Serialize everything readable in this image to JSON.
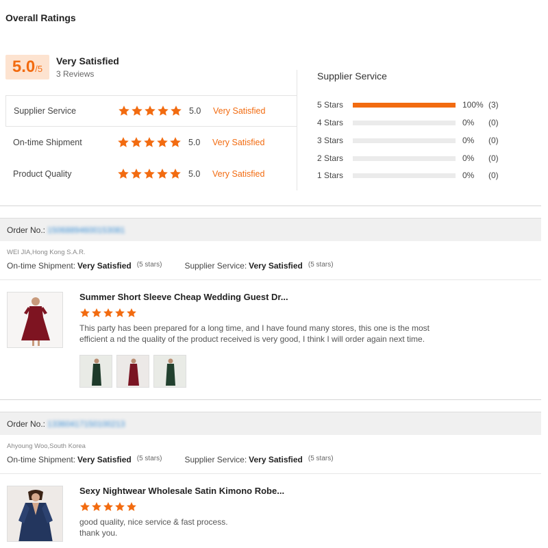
{
  "header": {
    "title": "Overall Ratings"
  },
  "overall": {
    "score": "5.0",
    "denominator": "/5",
    "label": "Very Satisfied",
    "reviews": "3 Reviews"
  },
  "metrics": [
    {
      "name": "Supplier Service",
      "value": "5.0",
      "text": "Very Satisfied",
      "stars": 5
    },
    {
      "name": "On-time Shipment",
      "value": "5.0",
      "text": "Very Satisfied",
      "stars": 5
    },
    {
      "name": "Product Quality",
      "value": "5.0",
      "text": "Very Satisfied",
      "stars": 5
    }
  ],
  "supplier_breakdown": {
    "title": "Supplier Service",
    "rows": [
      {
        "label": "5  Stars",
        "pct": "100%",
        "count": "(3)",
        "fraction": 1.0
      },
      {
        "label": "4  Stars",
        "pct": "0%",
        "count": "(0)",
        "fraction": 0
      },
      {
        "label": "3  Stars",
        "pct": "0%",
        "count": "(0)",
        "fraction": 0
      },
      {
        "label": "2  Stars",
        "pct": "0%",
        "count": "(0)",
        "fraction": 0
      },
      {
        "label": "1  Stars",
        "pct": "0%",
        "count": "(0)",
        "fraction": 0
      }
    ]
  },
  "reviews": [
    {
      "order_label": "Order No.:",
      "order_number": "15068894600153081",
      "buyer": "WEI JIA,Hong Kong S.A.R.",
      "shipment_label": "On-time Shipment:",
      "shipment_value": "Very Satisfied",
      "shipment_stars": "(5 stars)",
      "service_label": "Supplier Service:",
      "service_value": "Very Satisfied",
      "service_stars": "(5 stars)",
      "product_title": "Summer Short Sleeve Cheap Wedding Guest Dr...",
      "rating": 5,
      "text": "This party has been prepared for a long time, and I have found many stores, this one is the most efficient a nd the quality of the product received is very good, I think I will order again next time."
    },
    {
      "order_label": "Order No.:",
      "order_number": "13360417150100213",
      "buyer": "Ahyoung Woo,South Korea",
      "shipment_label": "On-time Shipment:",
      "shipment_value": "Very Satisfied",
      "shipment_stars": "(5 stars)",
      "service_label": "Supplier Service:",
      "service_value": "Very Satisfied",
      "service_stars": "(5 stars)",
      "product_title": "Sexy Nightwear Wholesale Satin Kimono Robe...",
      "rating": 5,
      "text": "good quality, nice service & fast process. thank you."
    }
  ],
  "colors": {
    "accent": "#f26b10",
    "link": "#3a8fd6",
    "score_bg": "#fde3d0"
  },
  "icons": {
    "star": "star-icon"
  }
}
